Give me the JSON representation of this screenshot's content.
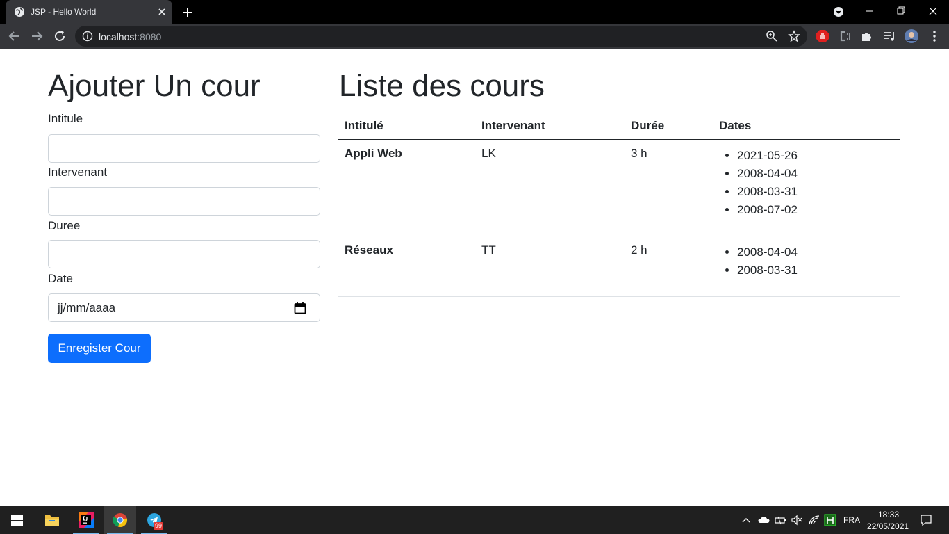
{
  "browser": {
    "tab_title": "JSP - Hello World",
    "url_host": "localhost",
    "url_port": ":8080"
  },
  "form": {
    "heading": "Ajouter Un cour",
    "fields": [
      {
        "label": "Intitule",
        "value": ""
      },
      {
        "label": "Intervenant",
        "value": ""
      },
      {
        "label": "Duree",
        "value": ""
      },
      {
        "label": "Date",
        "placeholder": "jj/mm/aaaa"
      }
    ],
    "submit_label": "Enregister Cour"
  },
  "list": {
    "heading": "Liste des cours",
    "columns": [
      "Intitulé",
      "Intervenant",
      "Durée",
      "Dates"
    ],
    "rows": [
      {
        "name": "Appli Web",
        "speaker": "LK",
        "duration": "3 h",
        "dates": [
          "2021-05-26",
          "2008-04-04",
          "2008-03-31",
          "2008-07-02"
        ]
      },
      {
        "name": "Réseaux",
        "speaker": "TT",
        "duration": "2 h",
        "dates": [
          "2008-04-04",
          "2008-03-31"
        ]
      }
    ]
  },
  "taskbar": {
    "language": "FRA",
    "time": "18:33",
    "date": "22/05/2021",
    "telegram_badge": "99"
  },
  "colors": {
    "primary_button": "#0d6efd",
    "chrome_bar": "#35363a",
    "taskbar": "#202020"
  }
}
